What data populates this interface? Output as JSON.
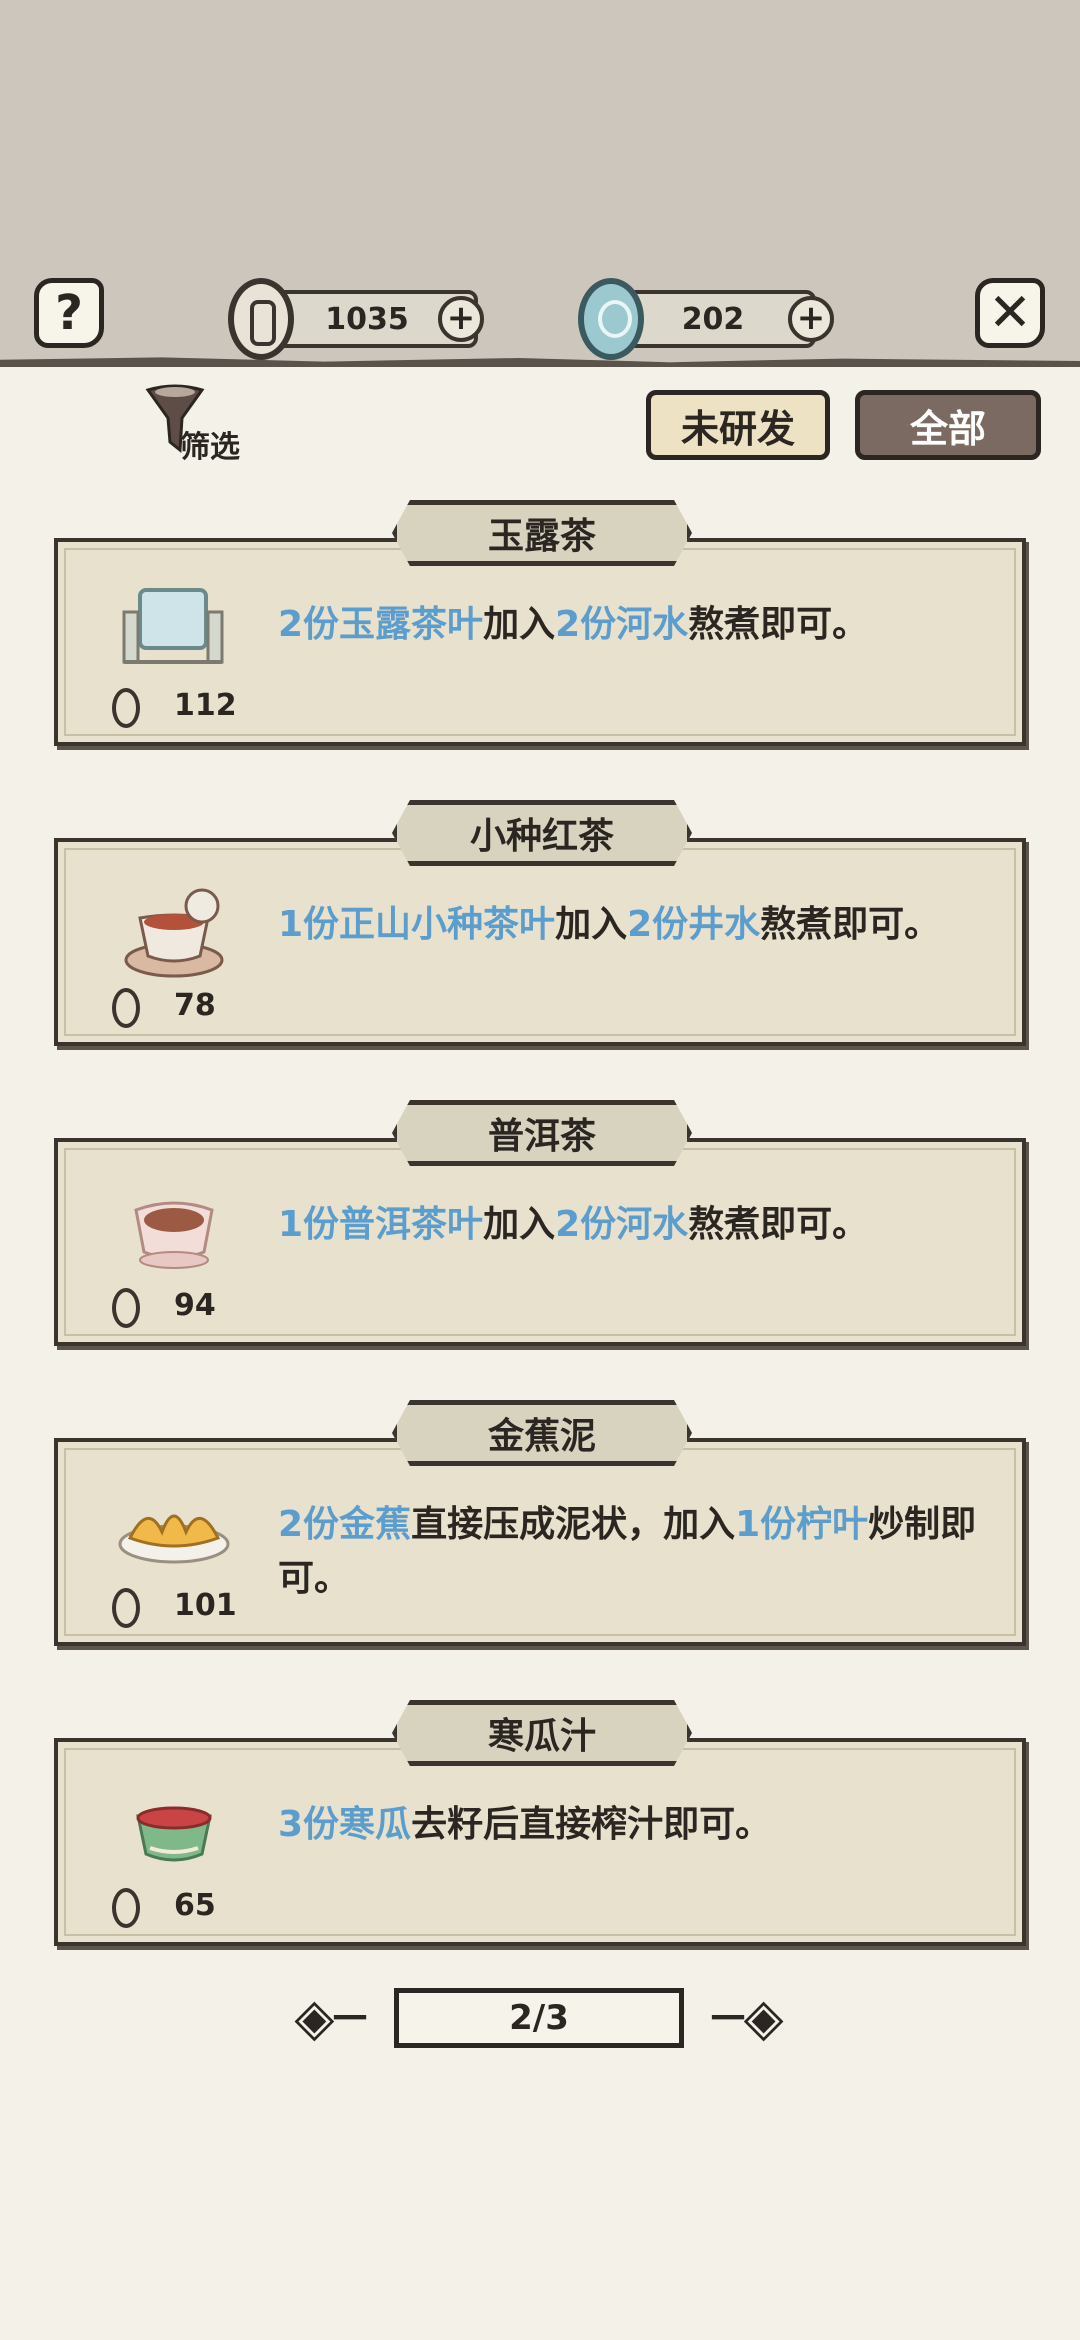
{
  "header": {
    "help_icon": "question-mark",
    "close_icon": "x-mark",
    "coins": "1035",
    "jade": "202"
  },
  "filter": {
    "label": "筛选"
  },
  "tabs": [
    {
      "label": "未研发",
      "active": false
    },
    {
      "label": "全部",
      "active": true
    }
  ],
  "recipes": [
    {
      "name": "玉露茶",
      "icon": "teacup-lantern-icon",
      "price": "112",
      "recipe_segments": [
        {
          "t": "2份玉露茶叶",
          "hl": true
        },
        {
          "t": "加入",
          "hl": false
        },
        {
          "t": "2份河水",
          "hl": true
        },
        {
          "t": "熬煮即可。",
          "hl": false
        }
      ]
    },
    {
      "name": "小种红茶",
      "icon": "red-tea-cup-icon",
      "price": "78",
      "recipe_segments": [
        {
          "t": "1份正山小种茶叶",
          "hl": true
        },
        {
          "t": "加入",
          "hl": false
        },
        {
          "t": "2份井水",
          "hl": true
        },
        {
          "t": "熬煮即可。",
          "hl": false
        }
      ]
    },
    {
      "name": "普洱茶",
      "icon": "puer-tea-cup-icon",
      "price": "94",
      "recipe_segments": [
        {
          "t": "1份普洱茶叶",
          "hl": true
        },
        {
          "t": "加入",
          "hl": false
        },
        {
          "t": "2份河水",
          "hl": true
        },
        {
          "t": "熬煮即可。",
          "hl": false
        }
      ]
    },
    {
      "name": "金蕉泥",
      "icon": "banana-dish-icon",
      "price": "101",
      "recipe_segments": [
        {
          "t": "2份金蕉",
          "hl": true
        },
        {
          "t": "直接压成泥状，加入",
          "hl": false
        },
        {
          "t": "1份柠叶",
          "hl": true
        },
        {
          "t": "炒制即可。",
          "hl": false
        }
      ]
    },
    {
      "name": "寒瓜汁",
      "icon": "watermelon-juice-bowl-icon",
      "price": "65",
      "recipe_segments": [
        {
          "t": "3份寒瓜",
          "hl": true
        },
        {
          "t": "去籽后直接榨汁即可。",
          "hl": false
        }
      ]
    }
  ],
  "pager": {
    "label": "2/3"
  }
}
